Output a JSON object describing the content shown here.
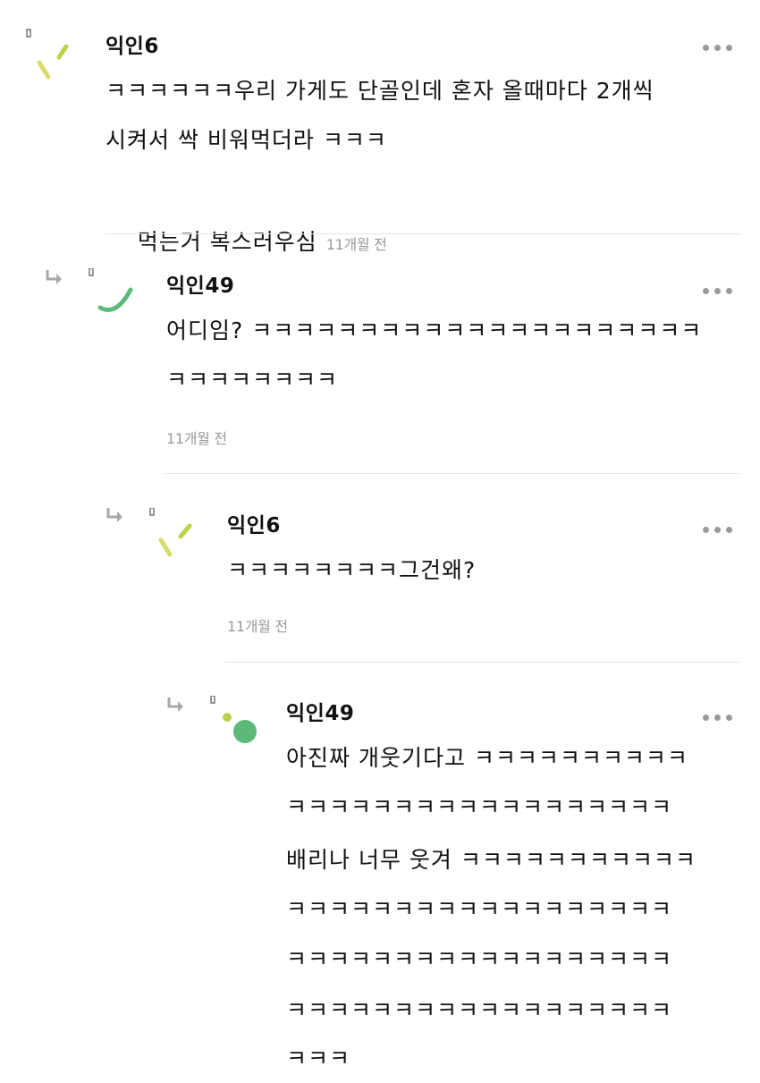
{
  "comments": [
    {
      "author": "익인6",
      "lines": [
        "ㅋㅋㅋㅋㅋㅋ우리 가게도 단골인데 혼자 올때마다 2개씩",
        "시켜서 싹 비워먹더라 ㅋㅋㅋ",
        "먹는거 복스러우심"
      ],
      "time": "11개월 전",
      "avatar_icon": "confetti-avatar-icon"
    },
    {
      "author": "익인49",
      "lines": [
        "어디임? ㅋㅋㅋㅋㅋㅋㅋㅋㅋㅋㅋㅋㅋㅋㅋㅋㅋㅋㅋㅋㅋ",
        "ㅋㅋㅋㅋㅋㅋㅋㅋ"
      ],
      "time": "11개월 전",
      "avatar_icon": "arc-avatar-icon"
    },
    {
      "author": "익인6",
      "lines": [
        "ㅋㅋㅋㅋㅋㅋㅋㅋ그건왜?"
      ],
      "time": "11개월 전",
      "avatar_icon": "confetti-avatar-icon"
    },
    {
      "author": "익인49",
      "lines": [
        "아진짜 개웃기다고 ㅋㅋㅋㅋㅋㅋㅋㅋㅋㅋ",
        "ㅋㅋㅋㅋㅋㅋㅋㅋㅋㅋㅋㅋㅋㅋㅋㅋㅋㅋ",
        "배리나 너무 웃겨 ㅋㅋㅋㅋㅋㅋㅋㅋㅋㅋㅋ",
        "ㅋㅋㅋㅋㅋㅋㅋㅋㅋㅋㅋㅋㅋㅋㅋㅋㅋㅋ",
        "ㅋㅋㅋㅋㅋㅋㅋㅋㅋㅋㅋㅋㅋㅋㅋㅋㅋㅋ",
        "ㅋㅋㅋㅋㅋㅋㅋㅋㅋㅋㅋㅋㅋㅋㅋㅋㅋㅋ",
        "ㅋㅋㅋ"
      ],
      "avatar_icon": "dots-avatar-icon"
    }
  ],
  "icons": {
    "reply": "reply-arrow-icon",
    "more": "more-options-icon"
  },
  "colors": {
    "avatar_lime": "#b8d44a",
    "avatar_yellow": "#d7dc6a",
    "avatar_green": "#5cb97a",
    "muted": "#9a9a9a",
    "divider": "#e6e6e6"
  }
}
